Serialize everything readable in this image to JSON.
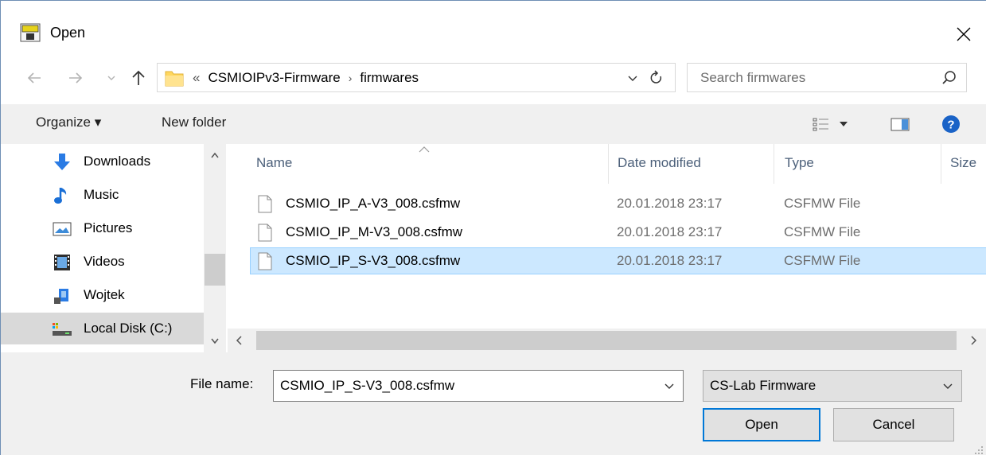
{
  "window": {
    "title": "Open"
  },
  "address": {
    "overflow": "«",
    "crumbs": [
      "CSMIOIPv3-Firmware",
      "firmwares"
    ],
    "separator": "›"
  },
  "search": {
    "placeholder": "Search firmwares"
  },
  "toolbar": {
    "organize_label": "Organize ▾",
    "new_folder_label": "New folder"
  },
  "sidebar": {
    "items": [
      {
        "label": "Downloads",
        "icon": "download-arrow-icon"
      },
      {
        "label": "Music",
        "icon": "music-note-icon"
      },
      {
        "label": "Pictures",
        "icon": "pictures-icon"
      },
      {
        "label": "Videos",
        "icon": "videos-icon"
      },
      {
        "label": "Wojtek",
        "icon": "user-folder-icon"
      },
      {
        "label": "Local Disk (C:)",
        "icon": "local-disk-icon",
        "selected": true
      }
    ]
  },
  "columns": {
    "name": "Name",
    "date": "Date modified",
    "type": "Type",
    "size": "Size"
  },
  "files": [
    {
      "name": "CSMIO_IP_A-V3_008.csfmw",
      "date": "20.01.2018 23:17",
      "type": "CSFMW File"
    },
    {
      "name": "CSMIO_IP_M-V3_008.csfmw",
      "date": "20.01.2018 23:17",
      "type": "CSFMW File"
    },
    {
      "name": "CSMIO_IP_S-V3_008.csfmw",
      "date": "20.01.2018 23:17",
      "type": "CSFMW File",
      "selected": true
    }
  ],
  "footer": {
    "filename_label": "File name:",
    "filename_value": "CSMIO_IP_S-V3_008.csfmw",
    "filetype_value": "CS-Lab Firmware",
    "open_label": "Open",
    "cancel_label": "Cancel"
  },
  "colors": {
    "selection_bg": "#cce8ff",
    "selection_border": "#99d1ff",
    "accent": "#0078d7",
    "header_text": "#4c607a"
  }
}
